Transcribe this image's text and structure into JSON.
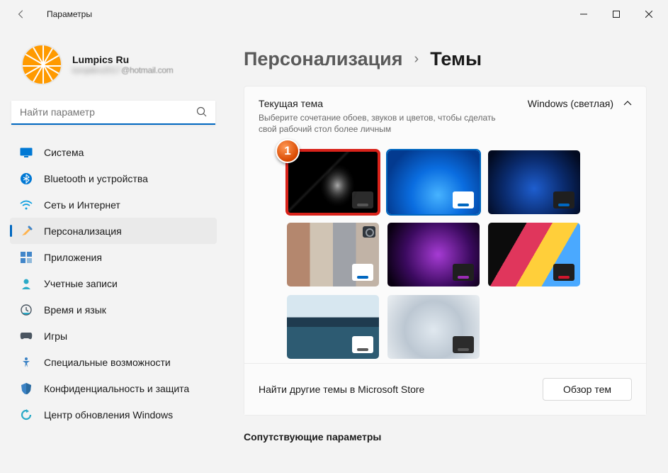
{
  "titlebar": {
    "title": "Параметры"
  },
  "profile": {
    "name": "Lumpics Ru",
    "email_suffix": "@hotmail.com"
  },
  "search": {
    "placeholder": "Найти параметр"
  },
  "nav": [
    {
      "id": "system",
      "label": "Система"
    },
    {
      "id": "bluetooth",
      "label": "Bluetooth и устройства"
    },
    {
      "id": "network",
      "label": "Сеть и Интернет"
    },
    {
      "id": "personalization",
      "label": "Персонализация",
      "active": true
    },
    {
      "id": "apps",
      "label": "Приложения"
    },
    {
      "id": "accounts",
      "label": "Учетные записи"
    },
    {
      "id": "time",
      "label": "Время и язык"
    },
    {
      "id": "gaming",
      "label": "Игры"
    },
    {
      "id": "accessibility",
      "label": "Специальные возможности"
    },
    {
      "id": "privacy",
      "label": "Конфиденциальность и защита"
    },
    {
      "id": "update",
      "label": "Центр обновления Windows"
    }
  ],
  "breadcrumb": {
    "parent": "Персонализация",
    "current": "Темы"
  },
  "current_theme": {
    "title": "Текущая тема",
    "description": "Выберите сочетание обоев, звуков и цветов, чтобы сделать свой рабочий стол более личным",
    "selected_label": "Windows (светлая)"
  },
  "annotation": {
    "badge": "1"
  },
  "footer": {
    "find_more": "Найти другие темы в Microsoft Store",
    "browse": "Обзор тем"
  },
  "related_heading": "Сопутствующие параметры"
}
